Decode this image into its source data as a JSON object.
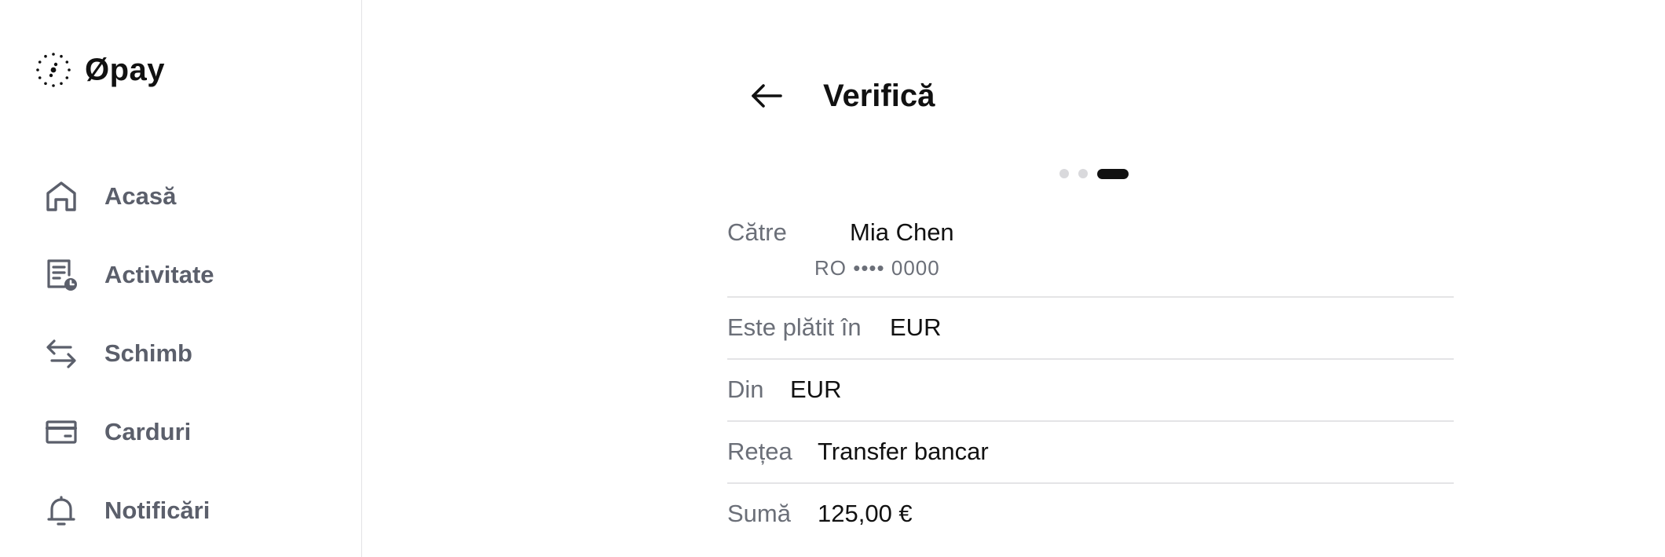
{
  "brand": {
    "name": "Øpay"
  },
  "sidebar": {
    "items": [
      {
        "label": "Acasă",
        "icon": "home-icon"
      },
      {
        "label": "Activitate",
        "icon": "activity-icon"
      },
      {
        "label": "Schimb",
        "icon": "exchange-icon"
      },
      {
        "label": "Carduri",
        "icon": "card-icon"
      },
      {
        "label": "Notificări",
        "icon": "bell-icon"
      }
    ]
  },
  "header": {
    "title": "Verifică",
    "back_icon": "arrow-left-icon"
  },
  "stepper": {
    "total": 3,
    "current": 3
  },
  "details": {
    "recipient": {
      "label": "Către",
      "name": "Mia Chen",
      "account": "RO •••• 0000"
    },
    "paid_in": {
      "label": "Este plătit în",
      "value": "EUR"
    },
    "from": {
      "label": "Din",
      "value": "EUR"
    },
    "network": {
      "label": "Rețea",
      "value": "Transfer bancar"
    },
    "amount": {
      "label": "Sumă",
      "value": "125,00 €"
    }
  },
  "colors": {
    "text": "#111111",
    "muted": "#6b6f78",
    "nav": "#5b5f6b",
    "divider": "#e4e4e6",
    "dot_inactive": "#d9d9dc"
  }
}
